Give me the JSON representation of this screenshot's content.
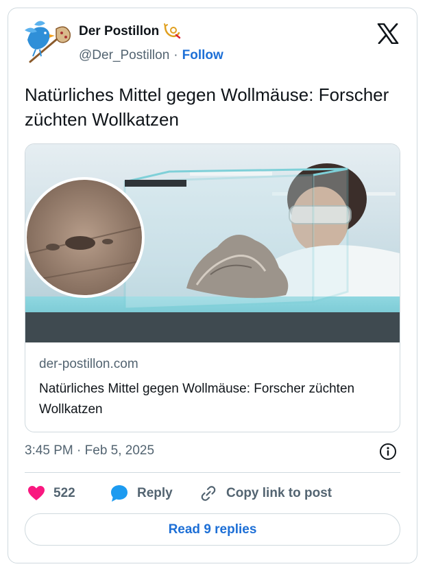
{
  "account": {
    "display_name": "Der Postillon",
    "handle": "@Der_Postillon",
    "separator": "·",
    "follow_label": "Follow"
  },
  "tweet": {
    "text": "Natürliches Mittel gegen Wollmäuse: Forscher züchten Wollkatzen",
    "timestamp": "3:45 PM · Feb 5, 2025"
  },
  "link_preview": {
    "domain": "der-postillon.com",
    "title": "Natürliches Mittel gegen Wollmäuse: Forscher züchten Wollkatzen"
  },
  "actions": {
    "like_count": "522",
    "reply_label": "Reply",
    "copy_label": "Copy link to post"
  },
  "read_replies_label": "Read 9 replies",
  "colors": {
    "link_blue": "#1d6fd6",
    "like_pink": "#f91880",
    "reply_blue": "#1d9bf0",
    "muted": "#536471",
    "border": "#cfd9de"
  },
  "icons": [
    "postillon-bird-avatar",
    "post-horn-badge-icon",
    "x-logo-icon",
    "info-icon",
    "heart-icon",
    "reply-bubble-icon",
    "link-icon"
  ]
}
